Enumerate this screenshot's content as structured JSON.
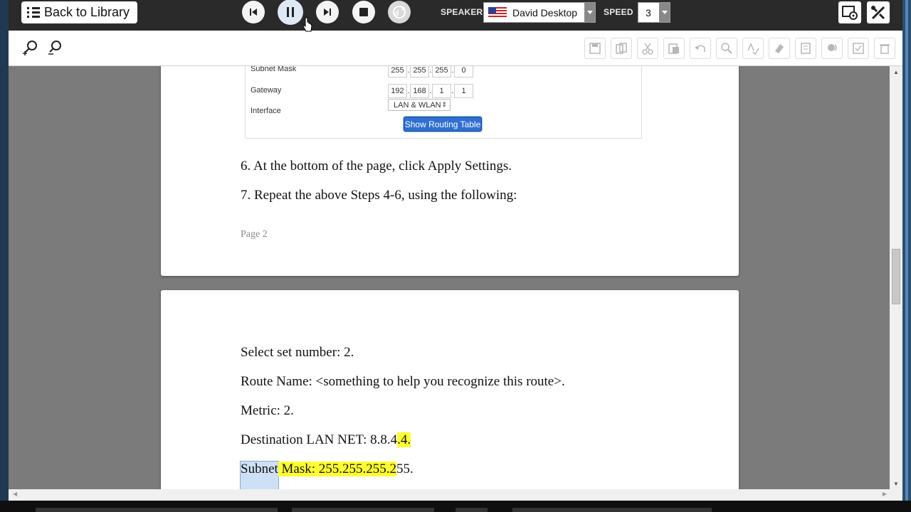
{
  "toolbar": {
    "back_label": "Back to Library",
    "speaker_label": "SPEAKER",
    "speaker_value": "David Desktop",
    "speed_label": "SPEED",
    "speed_value": "3"
  },
  "router_settings": {
    "subnet_mask_label": "Subnet Mask",
    "subnet_mask": [
      "255",
      "255",
      "255",
      "0"
    ],
    "gateway_label": "Gateway",
    "gateway": [
      "192",
      "168",
      "1",
      "1"
    ],
    "interface_label": "Interface",
    "interface_value": "LAN & WLAN",
    "routing_button": "Show Routing Table"
  },
  "page1": {
    "step6": "6. At the bottom of the page, click Apply Settings.",
    "step7": "7. Repeat the above Steps 4-6, using the following:",
    "footer": "Page 2"
  },
  "page2": {
    "line1": "Select set number: 2.",
    "line2": "Route Name: <something to help you recognize this route>.",
    "line3": "Metric: 2.",
    "line4_a": "Destination LAN NET: 8.8.4",
    "line4_b": ".4.",
    "line5_sel": "Subnet",
    "line5_hl": " Mask: 255.255.255.2",
    "line5_rest": "55."
  },
  "colors": {
    "highlight": "#ffff33",
    "selection": "#cde0f5",
    "button_blue": "#2f6fd1"
  }
}
